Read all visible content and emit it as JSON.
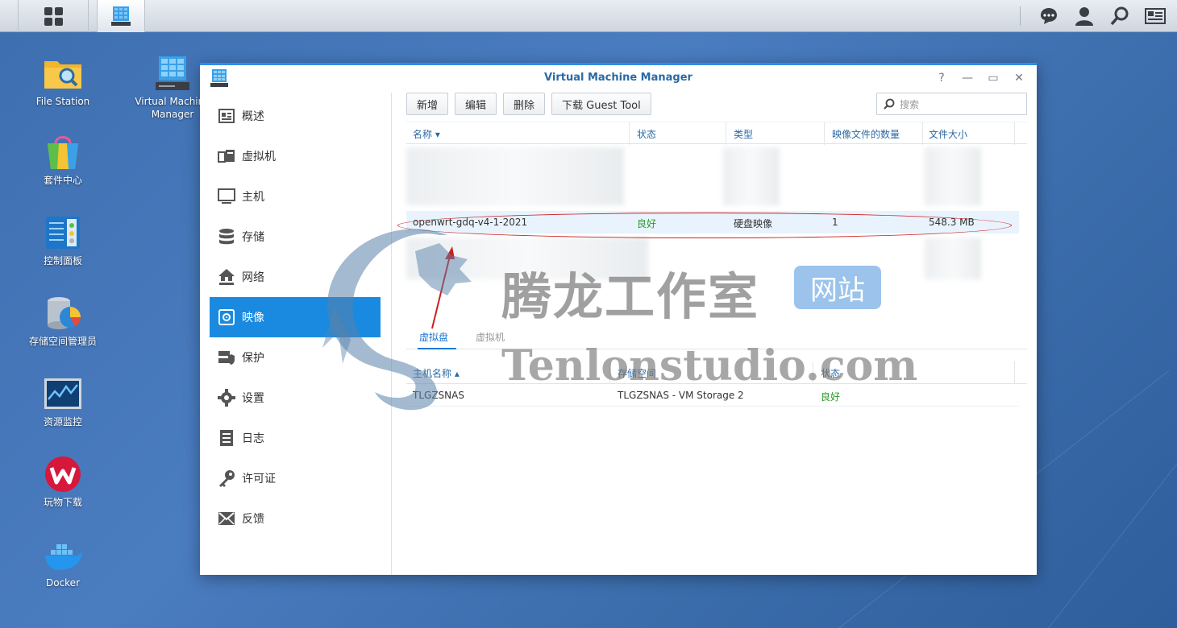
{
  "desktop": {
    "icons": [
      {
        "label": "File Station"
      },
      {
        "label": "Virtual Machine Manager"
      },
      {
        "label": "套件中心"
      },
      {
        "label": "控制面板"
      },
      {
        "label": "存储空间管理员"
      },
      {
        "label": "资源监控"
      },
      {
        "label": "玩物下载"
      },
      {
        "label": "Docker"
      }
    ]
  },
  "window": {
    "title": "Virtual Machine Manager",
    "controls": {
      "help": "?",
      "minimize": "—",
      "maximize": "▭",
      "close": "✕"
    }
  },
  "sidebar": {
    "items": [
      {
        "label": "概述",
        "icon": "overview-icon"
      },
      {
        "label": "虚拟机",
        "icon": "vm-icon"
      },
      {
        "label": "主机",
        "icon": "monitor-icon"
      },
      {
        "label": "存储",
        "icon": "database-icon"
      },
      {
        "label": "网络",
        "icon": "network-icon"
      },
      {
        "label": "映像",
        "icon": "disc-icon",
        "active": true
      },
      {
        "label": "保护",
        "icon": "shield-icon"
      },
      {
        "label": "设置",
        "icon": "gear-icon"
      },
      {
        "label": "日志",
        "icon": "log-icon"
      },
      {
        "label": "许可证",
        "icon": "key-icon"
      },
      {
        "label": "反馈",
        "icon": "mail-icon"
      }
    ]
  },
  "toolbar": {
    "add": "新增",
    "edit": "编辑",
    "delete": "删除",
    "download_guest_tool": "下载 Guest Tool",
    "search_placeholder": "搜索"
  },
  "image_table": {
    "columns": [
      "名称",
      "状态",
      "类型",
      "映像文件的数量",
      "文件大小"
    ],
    "sort_indicator": "▾",
    "selected_row": {
      "name": "openwrt-gdq-v4-1-2021",
      "status": "良好",
      "type": "硬盘映像",
      "count": "1",
      "size": "548.3 MB"
    }
  },
  "sub_tabs": {
    "tabs": [
      "虚拟盘",
      "虚拟机"
    ],
    "active": "虚拟盘"
  },
  "host_table": {
    "columns": [
      "主机名称",
      "存储空间",
      "状态"
    ],
    "sort_indicator": "▴",
    "rows": [
      {
        "host": "TLGZSNAS",
        "storage": "TLGZSNAS - VM Storage 2",
        "status": "良好"
      }
    ]
  },
  "watermark": {
    "cn": "腾龙工作室",
    "badge": "网站",
    "en": "Tenlonstudio.com"
  },
  "colors": {
    "accent": "#1a8ae0",
    "title": "#2a6aa5",
    "good": "#2b9a2b",
    "annotation": "#cc1f1f"
  }
}
